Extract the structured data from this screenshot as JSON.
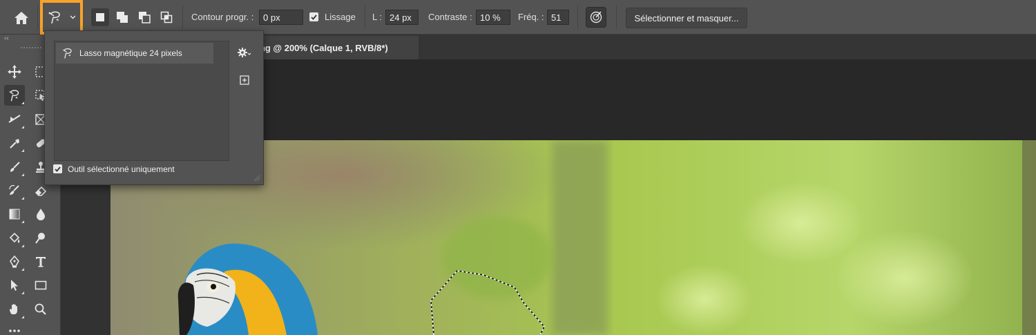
{
  "options_bar": {
    "contour_label": "Contour progr. :",
    "contour_value": "0 px",
    "lissage_label": "Lissage",
    "lissage_checked": true,
    "width_label": "L :",
    "width_value": "24 px",
    "contrast_label": "Contraste :",
    "contrast_value": "10 %",
    "freq_label": "Fréq. :",
    "freq_value": "51",
    "select_mask_label": "Sélectionner et masquer...",
    "highlight_color": "#f7a32b"
  },
  "document_tab": {
    "title": "png @ 200% (Calque 1, RVB/8*)"
  },
  "preset_popup": {
    "preset_name": "Lasso magnétique 24 pixels",
    "current_tool_only_label": "Outil sélectionné uniquement",
    "current_tool_only_checked": true
  },
  "toolbar": {
    "collapse_glyph": "‹‹",
    "tools": [
      "move-tool",
      "marquee-tool",
      "magnetic-lasso-tool",
      "object-select-tool",
      "crop-tool",
      "frame-tool",
      "eyedropper-tool",
      "spot-healing-tool",
      "brush-tool",
      "clone-stamp-tool",
      "history-brush-tool",
      "eraser-tool",
      "gradient-tool",
      "blur-tool",
      "dodge-tool",
      "sponge-tool",
      "pen-tool",
      "type-tool",
      "path-selection-tool",
      "rectangle-tool",
      "hand-tool",
      "zoom-tool"
    ]
  }
}
